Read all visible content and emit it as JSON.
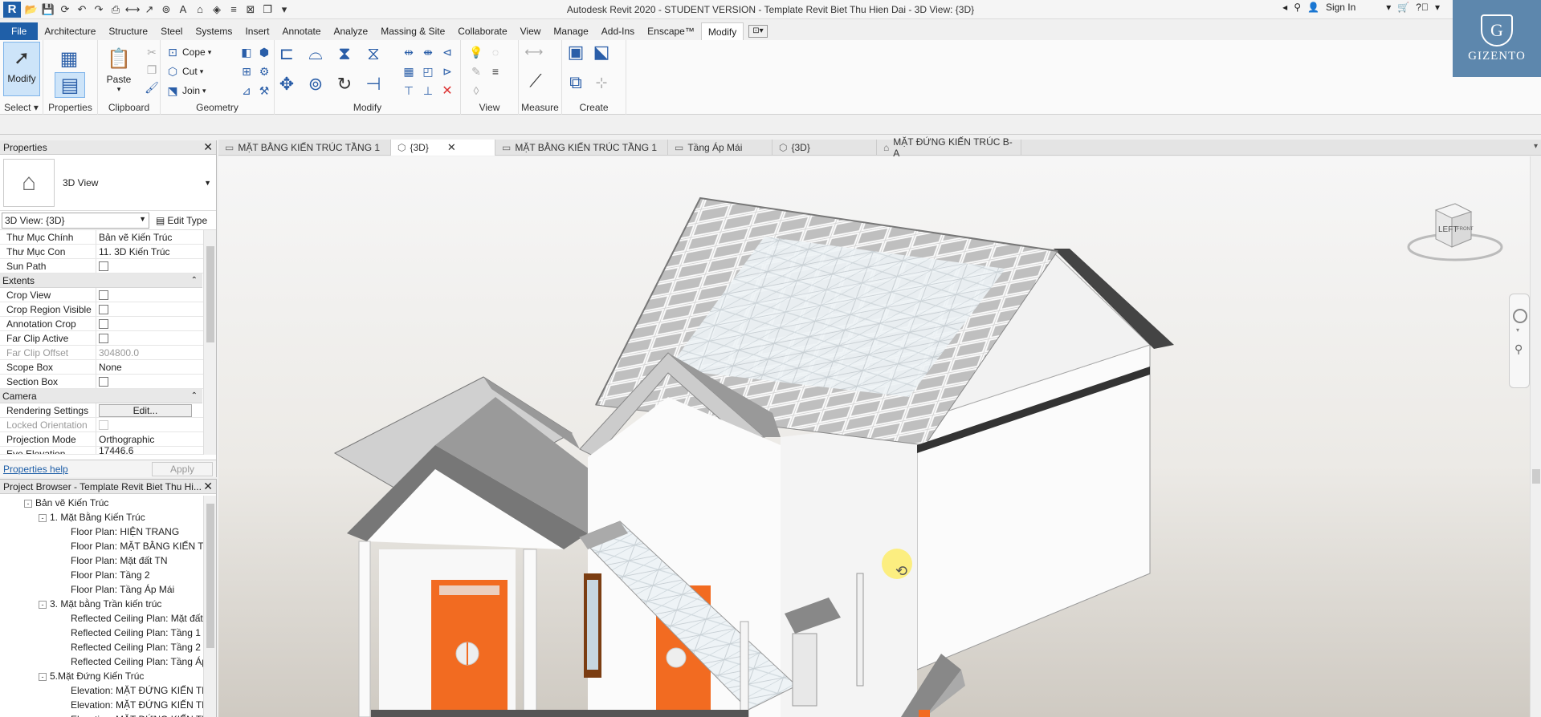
{
  "titlebar": {
    "app_title": "Autodesk Revit 2020 - STUDENT VERSION - Template Revit Biet Thu Hien Dai - 3D View: {3D}",
    "sign_in": "Sign In"
  },
  "ribbon_tabs": [
    "File",
    "Architecture",
    "Structure",
    "Steel",
    "Systems",
    "Insert",
    "Annotate",
    "Analyze",
    "Massing & Site",
    "Collaborate",
    "View",
    "Manage",
    "Add-Ins",
    "Enscape™",
    "Modify"
  ],
  "ribbon": {
    "select": {
      "modify_label": "Modify",
      "panel": "Select"
    },
    "properties": {
      "label": "Properties",
      "panel": "Properties"
    },
    "clipboard": {
      "paste_label": "Paste",
      "panel": "Clipboard"
    },
    "geometry": {
      "cope": "Cope",
      "cut": "Cut",
      "join": "Join",
      "panel": "Geometry"
    },
    "modify_panel": "Modify",
    "view_panel": "View",
    "measure_panel": "Measure",
    "create_panel": "Create"
  },
  "brand": {
    "letter": "G",
    "name": "GIZENTO"
  },
  "properties": {
    "title": "Properties",
    "type_name": "3D View",
    "view_selector": "3D View: {3D}",
    "edit_type": "Edit Type",
    "rows_top": [
      {
        "name": "Thư Mục Chính",
        "value": "Bản vẽ Kiến Trúc"
      },
      {
        "name": "Thư Mục Con",
        "value": "11. 3D Kiến Trúc"
      }
    ],
    "sun_path": "Sun Path",
    "sections": {
      "extents": "Extents",
      "camera": "Camera"
    },
    "extents_rows": [
      {
        "name": "Crop View",
        "type": "check"
      },
      {
        "name": "Crop Region Visible",
        "type": "check"
      },
      {
        "name": "Annotation Crop",
        "type": "check"
      },
      {
        "name": "Far Clip Active",
        "type": "check"
      }
    ],
    "far_clip_offset": {
      "name": "Far Clip Offset",
      "value": "304800.0"
    },
    "scope_box": {
      "name": "Scope Box",
      "value": "None"
    },
    "section_box": "Section Box",
    "camera_rows": {
      "rendering": {
        "name": "Rendering Settings",
        "value": "Edit..."
      },
      "locked": "Locked Orientation",
      "projection": {
        "name": "Projection Mode",
        "value": "Orthographic"
      },
      "eye": {
        "name": "Eye Elevation",
        "value": "17446.6"
      }
    },
    "help": "Properties help",
    "apply": "Apply"
  },
  "project_browser": {
    "title": "Project Browser - Template Revit Biet Thu Hi...",
    "items": [
      {
        "label": "Bản vẽ Kiến Trúc",
        "level": 0,
        "toggle": "-"
      },
      {
        "label": "1. Mặt Bằng Kiến Trúc",
        "level": 1,
        "toggle": "-"
      },
      {
        "label": "Floor Plan: HIỆN TRANG",
        "level": 2,
        "toggle": ""
      },
      {
        "label": "Floor Plan: MẶT BẰNG KIẾN TRÚ",
        "level": 2,
        "toggle": ""
      },
      {
        "label": "Floor Plan: Mặt đất TN",
        "level": 2,
        "toggle": ""
      },
      {
        "label": "Floor Plan: Tầng 2",
        "level": 2,
        "toggle": ""
      },
      {
        "label": "Floor Plan: Tầng Áp Mái",
        "level": 2,
        "toggle": ""
      },
      {
        "label": "3. Mặt bằng Trần kiến trúc",
        "level": 1,
        "toggle": "-"
      },
      {
        "label": "Reflected Ceiling Plan: Mặt đất",
        "level": 2,
        "toggle": ""
      },
      {
        "label": "Reflected Ceiling Plan: Tầng 1",
        "level": 2,
        "toggle": ""
      },
      {
        "label": "Reflected Ceiling Plan: Tầng 2",
        "level": 2,
        "toggle": ""
      },
      {
        "label": "Reflected Ceiling Plan: Tầng Áp",
        "level": 2,
        "toggle": ""
      },
      {
        "label": "5.Mặt Đứng Kiến Trúc",
        "level": 1,
        "toggle": "-"
      },
      {
        "label": "Elevation: MẶT ĐỨNG KIẾN TRÚ",
        "level": 2,
        "toggle": ""
      },
      {
        "label": "Elevation: MẶT ĐỨNG KIẾN TRÚ",
        "level": 2,
        "toggle": ""
      },
      {
        "label": "Elevation: MẶT ĐỨNG KIẾN TRÚ",
        "level": 2,
        "toggle": ""
      }
    ]
  },
  "view_tabs": [
    {
      "label": "MẶT BẰNG KIẾN TRÚC TẦNG 1",
      "icon": "floorplan-icon"
    },
    {
      "label": "{3D}",
      "icon": "3d-view-icon",
      "active": true
    },
    {
      "label": "MẶT BẰNG KIẾN TRÚC TẦNG 1",
      "icon": "floorplan-icon"
    },
    {
      "label": "Tầng Áp Mái",
      "icon": "floorplan-icon"
    },
    {
      "label": "{3D}",
      "icon": "3d-view-icon"
    },
    {
      "label": "MẶT ĐỨNG KIẾN TRÚC B-A",
      "icon": "elevation-icon"
    }
  ],
  "viewcube": {
    "left": "LEFT",
    "front": "FRONT"
  },
  "colors": {
    "revit_blue": "#1f5fa8",
    "brand_bg": "#5d87ad",
    "door_orange": "#f26b21"
  }
}
